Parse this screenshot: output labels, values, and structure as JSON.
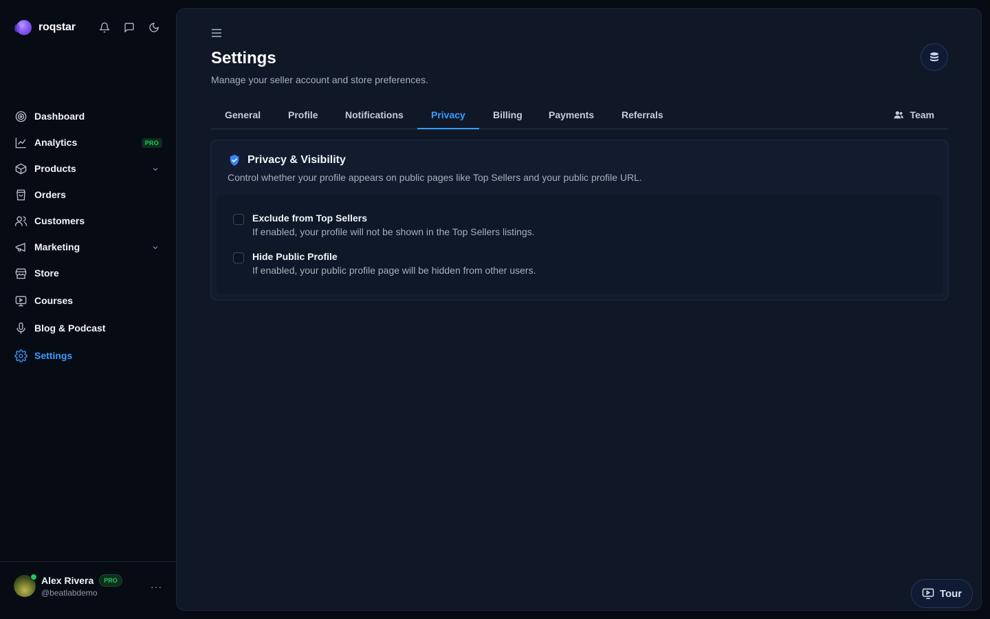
{
  "brand": {
    "name": "roqstar"
  },
  "top_icons": [
    "bell-icon",
    "message-icon",
    "moon-icon"
  ],
  "nav": {
    "items": [
      {
        "label": "Dashboard",
        "icon": "target-icon"
      },
      {
        "label": "Analytics",
        "icon": "chart-line-icon",
        "badge": "PRO"
      },
      {
        "label": "Products",
        "icon": "box-icon",
        "expandable": true
      },
      {
        "label": "Orders",
        "icon": "bag-icon"
      },
      {
        "label": "Customers",
        "icon": "users-icon"
      },
      {
        "label": "Marketing",
        "icon": "megaphone-icon",
        "expandable": true
      },
      {
        "label": "Store",
        "icon": "store-icon"
      },
      {
        "label": "Courses",
        "icon": "presentation-icon"
      },
      {
        "label": "Blog & Podcast",
        "icon": "mic-icon"
      },
      {
        "label": "Settings",
        "icon": "gear-icon",
        "active": true
      }
    ]
  },
  "user": {
    "name": "Alex Rivera",
    "badge": "PRO",
    "handle": "@beatlabdemo",
    "more": "···"
  },
  "page": {
    "title": "Settings",
    "subtitle": "Manage your seller account and store preferences."
  },
  "tabs": {
    "items": [
      "General",
      "Profile",
      "Notifications",
      "Privacy",
      "Billing",
      "Payments",
      "Referrals"
    ],
    "active": "Privacy",
    "team": "Team"
  },
  "privacy_card": {
    "title": "Privacy & Visibility",
    "description": "Control whether your profile appears on public pages like Top Sellers and your public profile URL.",
    "options": [
      {
        "title": "Exclude from Top Sellers",
        "description": "If enabled, your profile will not be shown in the Top Sellers listings.",
        "checked": false
      },
      {
        "title": "Hide Public Profile",
        "description": "If enabled, your public profile page will be hidden from other users.",
        "checked": false
      }
    ]
  },
  "tour": {
    "label": "Tour"
  },
  "colors": {
    "accent": "#3b9cff",
    "pro_green": "#22c55e",
    "background": "#070b14",
    "panel": "#101828"
  }
}
